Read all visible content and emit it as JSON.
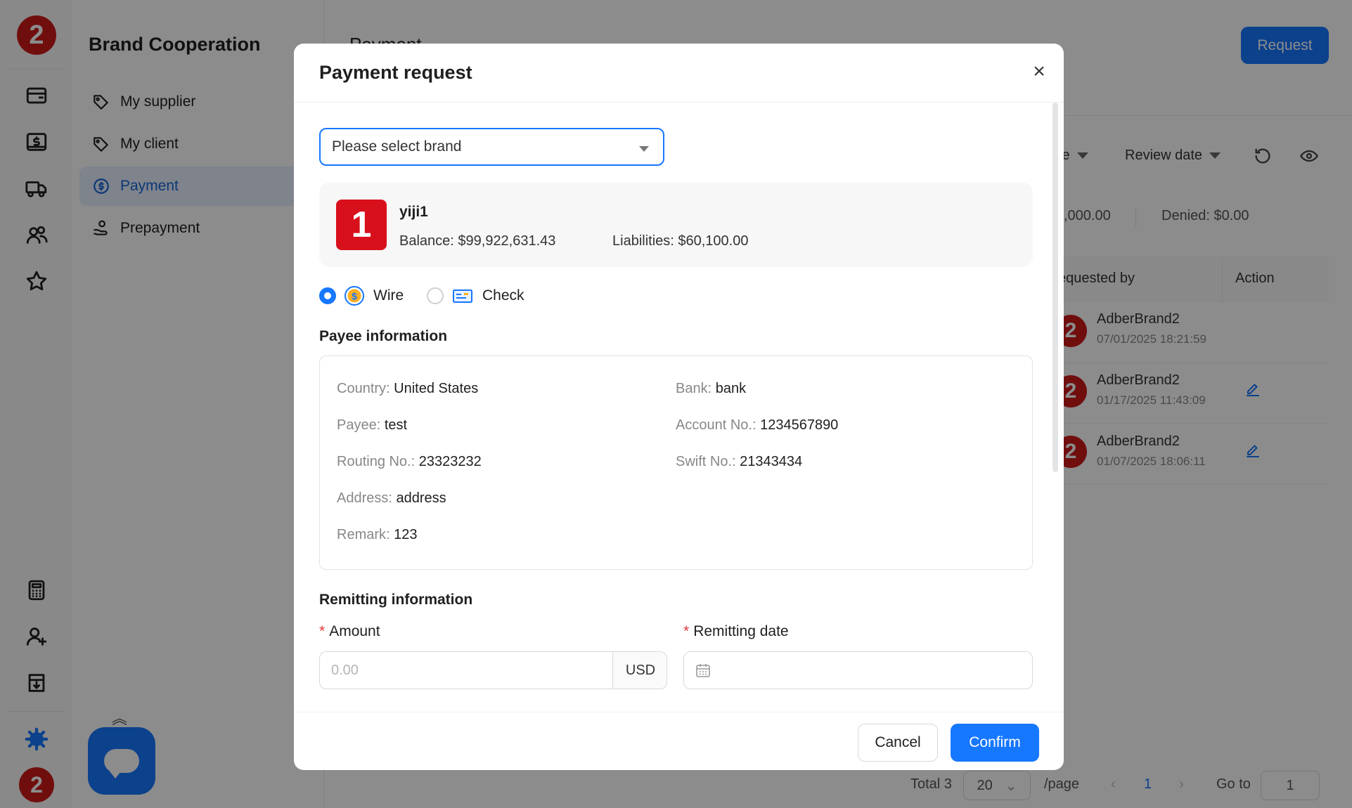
{
  "rail": {
    "logo_text": "2",
    "bottom_avatar_text": "2",
    "icons": [
      "wallet-icon",
      "dollar-bill-icon",
      "truck-icon",
      "users-icon",
      "star-icon",
      "calculator-icon",
      "user-add-icon",
      "download-box-icon",
      "gear-icon"
    ]
  },
  "nav": {
    "title": "Brand Cooperation",
    "items": [
      {
        "label": "My supplier",
        "icon": "tag-icon",
        "active": false
      },
      {
        "label": "My client",
        "icon": "tag-icon",
        "active": false
      },
      {
        "label": "Payment",
        "icon": "dollar-circle-icon",
        "active": true
      },
      {
        "label": "Prepayment",
        "icon": "hand-coin-icon",
        "active": false
      }
    ]
  },
  "page": {
    "title": "Payment",
    "request_button": "Request",
    "filters": [
      "te",
      "Review date"
    ],
    "stats": {
      "amount": ",000.00",
      "denied": "Denied: $0.00"
    },
    "table": {
      "headers": [
        "equested by",
        "Action"
      ],
      "rows": [
        {
          "avatar": "2",
          "name": "AdberBrand2",
          "date": "07/01/2025 18:21:59",
          "editable": false
        },
        {
          "avatar": "2",
          "name": "AdberBrand2",
          "date": "01/17/2025 11:43:09",
          "editable": true
        },
        {
          "avatar": "2",
          "name": "AdberBrand2",
          "date": "01/07/2025 18:06:11",
          "editable": true
        }
      ]
    },
    "pagination": {
      "total": "Total 3",
      "page_size": "20",
      "per_page": "/page",
      "current": "1",
      "goto_label": "Go to",
      "goto_value": "1"
    }
  },
  "modal": {
    "title": "Payment request",
    "close_icon": "close-icon",
    "brand_select": {
      "placeholder": "Please select brand"
    },
    "brand": {
      "logo_text": "1",
      "name": "yiji1",
      "balance": "Balance: $99,922,631.43",
      "liabilities": "Liabilities: $60,100.00"
    },
    "payment_methods": [
      {
        "label": "Wire",
        "icon": "dollar-coin-icon",
        "selected": true
      },
      {
        "label": "Check",
        "icon": "check-card-icon",
        "selected": false
      }
    ],
    "payee": {
      "section_title": "Payee information",
      "left": [
        {
          "key": "Country:",
          "value": "United States"
        },
        {
          "key": "Payee:",
          "value": "test"
        },
        {
          "key": "Routing No.:",
          "value": "23323232"
        },
        {
          "key": "Address:",
          "value": "address"
        },
        {
          "key": "Remark:",
          "value": "123"
        }
      ],
      "right": [
        {
          "key": "Bank:",
          "value": "bank"
        },
        {
          "key": "Account No.:",
          "value": "1234567890"
        },
        {
          "key": "Swift No.:",
          "value": "21343434"
        }
      ]
    },
    "remitting": {
      "section_title": "Remitting information",
      "amount_label": "Amount",
      "amount_placeholder": "0.00",
      "amount_value": "",
      "currency": "USD",
      "date_label": "Remitting date",
      "required_mark": "*"
    },
    "buttons": {
      "cancel": "Cancel",
      "confirm": "Confirm"
    }
  },
  "colors": {
    "accent": "#1677ff",
    "brand_red": "#d8101c",
    "avatar_red": "#cc1a1a",
    "required": "#e4393c"
  }
}
